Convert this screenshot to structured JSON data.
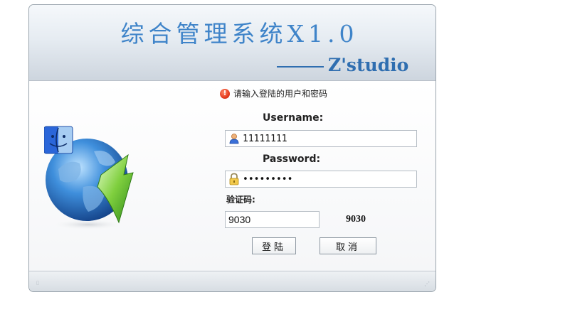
{
  "header": {
    "title": "综合管理系统X1.0",
    "studio": "Z'studio"
  },
  "message": {
    "text": "请输入登陆的用户和密码",
    "icon": "alert-icon"
  },
  "form": {
    "username_label": "Username:",
    "username_value": "11111111",
    "password_label": "Password:",
    "password_value": "123456789",
    "captcha_label": "验证码:",
    "captcha_value": "9030",
    "captcha_code": "9030"
  },
  "buttons": {
    "login": "登陆",
    "cancel": "取消"
  },
  "icons": {
    "user": "user-icon",
    "lock": "lock-icon",
    "globe": "globe-login-icon"
  },
  "colors": {
    "title": "#3f84c9",
    "studio": "#2f6eb0",
    "alert": "#e53b1e"
  }
}
